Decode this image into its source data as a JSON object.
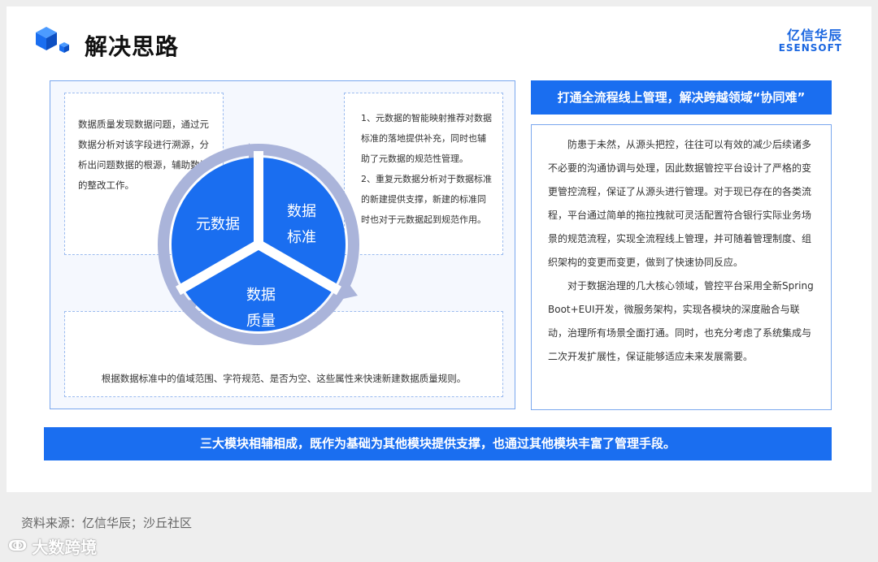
{
  "header": {
    "title": "解决思路",
    "brand_cn": "亿信华辰",
    "brand_en": "ESENSOFT"
  },
  "colors": {
    "primary": "#1a6ef0",
    "arrow_ring": "#aab4da",
    "panel_border": "#7aa7ee"
  },
  "cycle": {
    "segments": [
      {
        "label_line1": "元数据",
        "label_line2": ""
      },
      {
        "label_line1": "数据",
        "label_line2": "标准"
      },
      {
        "label_line1": "数据",
        "label_line2": "质量"
      }
    ]
  },
  "notes": {
    "top_left": "数据质量发现数据问题，通过元数据分析对该字段进行溯源，分析出问题数据的根源，辅助数据的整改工作。",
    "top_right_1": "1、元数据的智能映射推荐对数据标准的落地提供补充，同时也辅助了元数据的规范性管理。",
    "top_right_2": "2、重复元数据分析对于数据标准的新建提供支撑，新建的标准同时也对于元数据起到规范作用。",
    "bottom": "根据数据标准中的值域范围、字符规范、是否为空、这些属性来快速新建数据质量规则。"
  },
  "right": {
    "banner": "打通全流程线上管理，解决跨越领域“协同难”",
    "para1": "防患于未然，从源头把控，往往可以有效的减少后续诸多不必要的沟通协调与处理，因此数据管控平台设计了严格的变更管控流程，保证了从源头进行管理。对于现已存在的各类流程，平台通过简单的拖拉拽就可灵活配置符合银行实际业务场景的规范流程，实现全流程线上管理，并可随着管理制度、组织架构的变更而变更，做到了快速协同反应。",
    "para2": "对于数据治理的几大核心领域，管控平台采用全新Spring Boot+EUI开发，微服务架构，实现各模块的深度融合与联动，治理所有场景全面打通。同时，也充分考虑了系统集成与二次开发扩展性，保证能够适应未来发展需要。"
  },
  "bottom_banner": "三大模块相辅相成，既作为基础为其他模块提供支撑，也通过其他模块丰富了管理手段。",
  "footer": {
    "source": "资料来源：亿信华辰；沙丘社区",
    "watermark": "大数跨境",
    "watermark_icon": "swirl-logo-icon"
  }
}
